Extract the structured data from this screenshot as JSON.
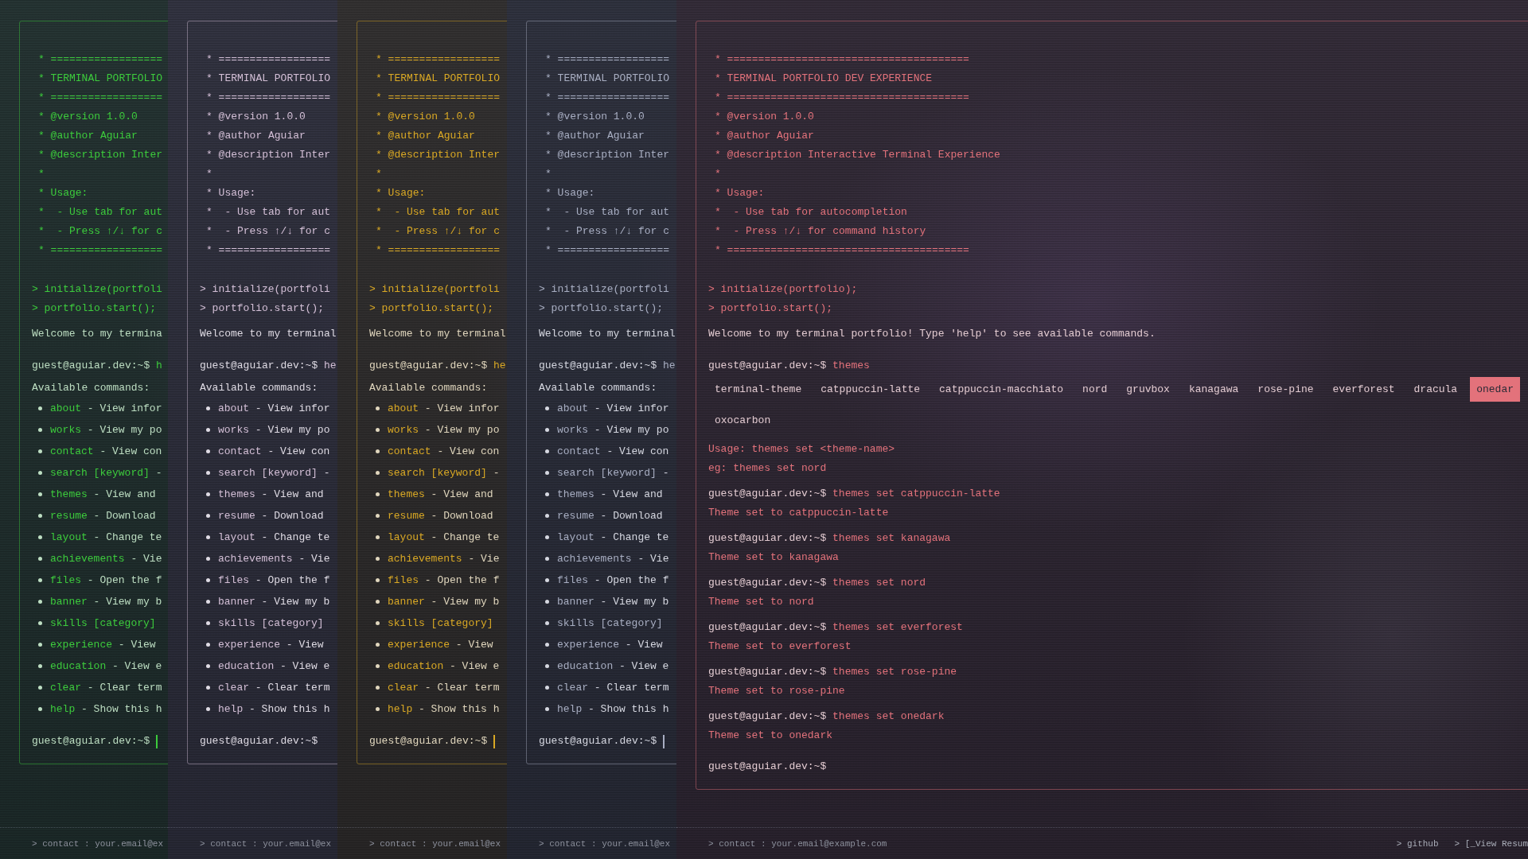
{
  "panels": [
    {
      "color": "#3ccb3c",
      "header": [
        "* ==================",
        "* TERMINAL PORTFOLIO",
        "* ==================",
        "* @version 1.0.0",
        "* @author Aguiar",
        "* @description Inter",
        "*",
        "* Usage:",
        "*  - Use tab for aut",
        "*  - Press ↑/↓ for c",
        "* =================="
      ],
      "boot": [
        "> initialize(portfoli",
        "> portfolio.start();"
      ],
      "welcome": "Welcome to my termina",
      "blocks": [
        {
          "kind": "input",
          "prompt": "guest@aguiar.dev:~$",
          "command": "h"
        },
        {
          "kind": "help",
          "title": "Available commands:",
          "items": [
            {
              "command": "about",
              "description": "- View infor"
            },
            {
              "command": "works",
              "description": "- View my po"
            },
            {
              "command": "contact",
              "description": "- View con"
            },
            {
              "command": "search [keyword]",
              "description": "-"
            },
            {
              "command": "themes",
              "description": "- View and"
            },
            {
              "command": "resume",
              "description": "- Download"
            },
            {
              "command": "layout",
              "description": "- Change te"
            },
            {
              "command": "achievements",
              "description": "- Vie"
            },
            {
              "command": "files",
              "description": "- Open the f"
            },
            {
              "command": "banner",
              "description": "- View my b"
            },
            {
              "command": "skills [category]"
            },
            {
              "command": "experience",
              "description": "- View"
            },
            {
              "command": "education",
              "description": "- View e"
            },
            {
              "command": "clear",
              "description": "- Clear term"
            },
            {
              "command": "help",
              "description": "- Show this h"
            }
          ]
        },
        {
          "kind": "input",
          "prompt": "guest@aguiar.dev:~$",
          "cursor_visible": true
        }
      ],
      "footer": {
        "contact": "> contact : your.email@ex"
      }
    },
    {
      "color": "#d3bfd6",
      "header": [
        "* ==================",
        "* TERMINAL PORTFOLIO",
        "* ==================",
        "* @version 1.0.0",
        "* @author Aguiar",
        "* @description Inter",
        "*",
        "* Usage:",
        "*  - Use tab for aut",
        "*  - Press ↑/↓ for c",
        "* =================="
      ],
      "boot": [
        "> initialize(portfoli",
        "> portfolio.start();"
      ],
      "welcome": "Welcome to my terminal",
      "blocks": [
        {
          "kind": "input",
          "prompt": "guest@aguiar.dev:~$",
          "command": "he"
        },
        {
          "kind": "help",
          "title": "Available commands:",
          "items": [
            {
              "command": "about",
              "description": "- View infor"
            },
            {
              "command": "works",
              "description": "- View my po"
            },
            {
              "command": "contact",
              "description": "- View con"
            },
            {
              "command": "search [keyword]",
              "description": "-"
            },
            {
              "command": "themes",
              "description": "- View and"
            },
            {
              "command": "resume",
              "description": "- Download"
            },
            {
              "command": "layout",
              "description": "- Change te"
            },
            {
              "command": "achievements",
              "description": "- Vie"
            },
            {
              "command": "files",
              "description": "- Open the f"
            },
            {
              "command": "banner",
              "description": "- View my b"
            },
            {
              "command": "skills [category]"
            },
            {
              "command": "experience",
              "description": "- View"
            },
            {
              "command": "education",
              "description": "- View e"
            },
            {
              "command": "clear",
              "description": "- Clear term"
            },
            {
              "command": "help",
              "description": "- Show this h"
            }
          ]
        },
        {
          "kind": "input",
          "prompt": "guest@aguiar.dev:~$",
          "cursor_visible": false
        }
      ],
      "footer": {
        "contact": "> contact : your.email@ex"
      }
    },
    {
      "color": "#d9a824",
      "header": [
        "* ==================",
        "* TERMINAL PORTFOLIO",
        "* ==================",
        "* @version 1.0.0",
        "* @author Aguiar",
        "* @description Inter",
        "*",
        "* Usage:",
        "*  - Use tab for aut",
        "*  - Press ↑/↓ for c",
        "* =================="
      ],
      "boot": [
        "> initialize(portfoli",
        "> portfolio.start();"
      ],
      "welcome": "Welcome to my terminal",
      "blocks": [
        {
          "kind": "input",
          "prompt": "guest@aguiar.dev:~$",
          "command": "he"
        },
        {
          "kind": "help",
          "title": "Available commands:",
          "items": [
            {
              "command": "about",
              "description": "- View infor"
            },
            {
              "command": "works",
              "description": "- View my po"
            },
            {
              "command": "contact",
              "description": "- View con"
            },
            {
              "command": "search [keyword]",
              "description": "-"
            },
            {
              "command": "themes",
              "description": "- View and"
            },
            {
              "command": "resume",
              "description": "- Download"
            },
            {
              "command": "layout",
              "description": "- Change te"
            },
            {
              "command": "achievements",
              "description": "- Vie"
            },
            {
              "command": "files",
              "description": "- Open the f"
            },
            {
              "command": "banner",
              "description": "- View my b"
            },
            {
              "command": "skills [category]"
            },
            {
              "command": "experience",
              "description": "- View"
            },
            {
              "command": "education",
              "description": "- View e"
            },
            {
              "command": "clear",
              "description": "- Clear term"
            },
            {
              "command": "help",
              "description": "- Show this h"
            }
          ]
        },
        {
          "kind": "input",
          "prompt": "guest@aguiar.dev:~$",
          "cursor_visible": true
        }
      ],
      "footer": {
        "contact": "> contact : your.email@ex"
      }
    },
    {
      "color": "#a8aec2",
      "header": [
        "* ==================",
        "* TERMINAL PORTFOLIO",
        "* ==================",
        "* @version 1.0.0",
        "* @author Aguiar",
        "* @description Inter",
        "*",
        "* Usage:",
        "*  - Use tab for aut",
        "*  - Press ↑/↓ for c",
        "* =================="
      ],
      "boot": [
        "> initialize(portfoli",
        "> portfolio.start();"
      ],
      "welcome": "Welcome to my terminal",
      "blocks": [
        {
          "kind": "input",
          "prompt": "guest@aguiar.dev:~$",
          "command": "he"
        },
        {
          "kind": "help",
          "title": "Available commands:",
          "items": [
            {
              "command": "about",
              "description": "- View infor"
            },
            {
              "command": "works",
              "description": "- View my po"
            },
            {
              "command": "contact",
              "description": "- View con"
            },
            {
              "command": "search [keyword]",
              "description": "-"
            },
            {
              "command": "themes",
              "description": "- View and"
            },
            {
              "command": "resume",
              "description": "- Download"
            },
            {
              "command": "layout",
              "description": "- Change te"
            },
            {
              "command": "achievements",
              "description": "- Vie"
            },
            {
              "command": "files",
              "description": "- Open the f"
            },
            {
              "command": "banner",
              "description": "- View my b"
            },
            {
              "command": "skills [category]"
            },
            {
              "command": "experience",
              "description": "- View"
            },
            {
              "command": "education",
              "description": "- View e"
            },
            {
              "command": "clear",
              "description": "- Clear term"
            },
            {
              "command": "help",
              "description": "- Show this h"
            }
          ]
        },
        {
          "kind": "input",
          "prompt": "guest@aguiar.dev:~$",
          "cursor_visible": true
        }
      ],
      "footer": {
        "contact": "> contact : your.email@ex"
      }
    },
    {
      "color": "#e3727b",
      "header": [
        "* =======================================",
        "* TERMINAL PORTFOLIO DEV EXPERIENCE",
        "* =======================================",
        "* @version 1.0.0",
        "* @author Aguiar",
        "* @description Interactive Terminal Experience",
        "*",
        "* Usage:",
        "*  - Use tab for autocompletion",
        "*  - Press ↑/↓ for command history",
        "* ======================================="
      ],
      "boot": [
        "> initialize(portfolio);",
        "> portfolio.start();"
      ],
      "welcome": "Welcome to my terminal portfolio! Type 'help' to see available commands.",
      "blocks": [
        {
          "kind": "input",
          "prompt": "guest@aguiar.dev:~$",
          "command": "themes"
        },
        {
          "kind": "chips",
          "items": [
            {
              "label": "terminal-theme",
              "selected": false
            },
            {
              "label": "catppuccin-latte",
              "selected": false
            },
            {
              "label": "catppuccin-macchiato",
              "selected": false
            },
            {
              "label": "nord",
              "selected": false
            },
            {
              "label": "gruvbox",
              "selected": false
            },
            {
              "label": "kanagawa",
              "selected": false
            },
            {
              "label": "rose-pine",
              "selected": false
            },
            {
              "label": "everforest",
              "selected": false
            },
            {
              "label": "dracula",
              "selected": false
            },
            {
              "label": "onedar",
              "selected": true
            },
            {
              "label": "oxocarbon",
              "selected": false
            }
          ]
        },
        {
          "kind": "output",
          "lines": [
            "Usage: themes set <theme-name>",
            "eg: themes set nord"
          ]
        },
        {
          "kind": "input",
          "prompt": "guest@aguiar.dev:~$",
          "command": "themes set catppuccin-latte"
        },
        {
          "kind": "output",
          "lines": [
            "Theme set to catppuccin-latte"
          ]
        },
        {
          "kind": "input",
          "prompt": "guest@aguiar.dev:~$",
          "command": "themes set kanagawa"
        },
        {
          "kind": "output",
          "lines": [
            "Theme set to kanagawa"
          ]
        },
        {
          "kind": "input",
          "prompt": "guest@aguiar.dev:~$",
          "command": "themes set nord"
        },
        {
          "kind": "output",
          "lines": [
            "Theme set to nord"
          ]
        },
        {
          "kind": "input",
          "prompt": "guest@aguiar.dev:~$",
          "command": "themes set everforest"
        },
        {
          "kind": "output",
          "lines": [
            "Theme set to everforest"
          ]
        },
        {
          "kind": "input",
          "prompt": "guest@aguiar.dev:~$",
          "command": "themes set rose-pine"
        },
        {
          "kind": "output",
          "lines": [
            "Theme set to rose-pine"
          ]
        },
        {
          "kind": "input",
          "prompt": "guest@aguiar.dev:~$",
          "command": "themes set onedark"
        },
        {
          "kind": "output",
          "lines": [
            "Theme set to onedark"
          ]
        },
        {
          "kind": "input",
          "prompt": "guest@aguiar.dev:~$",
          "cursor_visible": false
        }
      ],
      "footer": {
        "contact": "> contact : your.email@example.com",
        "links": [
          "> github",
          "> [_View Resum"
        ]
      }
    }
  ]
}
